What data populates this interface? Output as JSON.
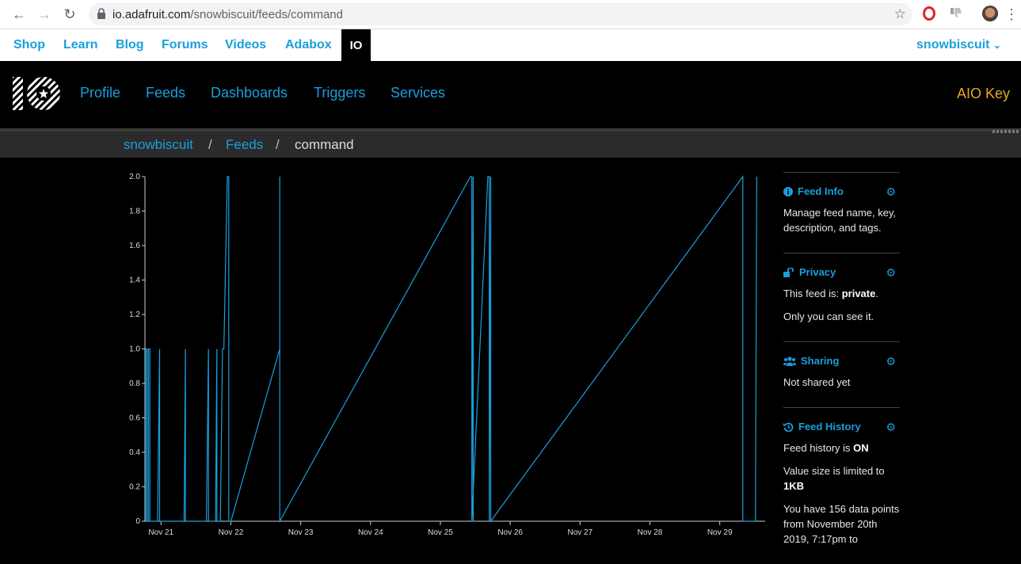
{
  "browser": {
    "url_host": "io.adafruit.com",
    "url_path": "/snowbiscuit/feeds/command"
  },
  "topbar": {
    "links": [
      "Shop",
      "Learn",
      "Blog",
      "Forums",
      "Videos",
      "Adabox"
    ],
    "active_tab": "IO",
    "user": "snowbiscuit"
  },
  "ionav": {
    "items": [
      "Profile",
      "Feeds",
      "Dashboards",
      "Triggers",
      "Services"
    ],
    "aio_key": "AIO Key"
  },
  "breadcrumb": {
    "user": "snowbiscuit",
    "sep": "/",
    "feeds": "Feeds",
    "current": "command"
  },
  "chart_data": {
    "type": "line",
    "x_ticks": [
      "Nov 21",
      "Nov 22",
      "Nov 23",
      "Nov 24",
      "Nov 25",
      "Nov 26",
      "Nov 27",
      "Nov 28",
      "Nov 29"
    ],
    "y_ticks": [
      "0",
      "0.2",
      "0.4",
      "0.6",
      "0.8",
      "1.0",
      "1.2",
      "1.4",
      "1.6",
      "1.8",
      "2.0"
    ],
    "ylim": [
      0,
      2
    ],
    "xlim_days": [
      20.77,
      29.65
    ],
    "series": [
      {
        "color": "#1a9fdc",
        "points": [
          [
            20.78,
            0
          ],
          [
            20.78,
            1
          ],
          [
            20.8,
            1
          ],
          [
            20.8,
            0
          ],
          [
            20.82,
            0
          ],
          [
            20.82,
            1
          ],
          [
            20.84,
            1
          ],
          [
            20.84,
            0
          ],
          [
            20.95,
            0
          ],
          [
            20.98,
            1
          ],
          [
            20.98,
            0
          ],
          [
            21.33,
            0
          ],
          [
            21.35,
            1
          ],
          [
            21.35,
            0
          ],
          [
            21.65,
            0
          ],
          [
            21.68,
            1
          ],
          [
            21.68,
            0
          ],
          [
            21.78,
            0
          ],
          [
            21.8,
            1
          ],
          [
            21.8,
            0
          ],
          [
            21.85,
            0
          ],
          [
            21.88,
            1
          ],
          [
            21.9,
            1
          ],
          [
            21.95,
            2
          ],
          [
            21.97,
            2
          ],
          [
            21.97,
            0
          ],
          [
            22.0,
            0
          ],
          [
            22.7,
            1
          ],
          [
            22.7,
            2
          ],
          [
            22.7,
            0
          ],
          [
            25.43,
            2
          ],
          [
            25.45,
            2
          ],
          [
            25.45,
            0
          ],
          [
            25.47,
            0
          ],
          [
            25.47,
            2
          ],
          [
            25.45,
            0
          ],
          [
            25.68,
            2
          ],
          [
            25.7,
            2
          ],
          [
            25.7,
            0
          ],
          [
            25.72,
            2
          ],
          [
            25.72,
            0
          ],
          [
            29.33,
            2
          ],
          [
            29.33,
            0
          ],
          [
            29.51,
            0
          ],
          [
            29.53,
            2
          ]
        ]
      }
    ]
  },
  "sidebar": {
    "feed_info": {
      "title": "Feed Info",
      "text": "Manage feed name, key, description, and tags."
    },
    "privacy": {
      "title": "Privacy",
      "line1_prefix": "This feed is: ",
      "line1_value": "private",
      "line1_suffix": ".",
      "line2": "Only you can see it."
    },
    "sharing": {
      "title": "Sharing",
      "text": "Not shared yet"
    },
    "history": {
      "title": "Feed History",
      "line1_prefix": "Feed history is ",
      "line1_value": "ON",
      "line2_prefix": "Value size is limited to ",
      "line2_value": "1KB",
      "line3": "You have 156 data points from November 20th 2019, 7:17pm to"
    }
  },
  "colors": {
    "accent": "#1a9fdc",
    "aio_key": "#e5a823"
  }
}
